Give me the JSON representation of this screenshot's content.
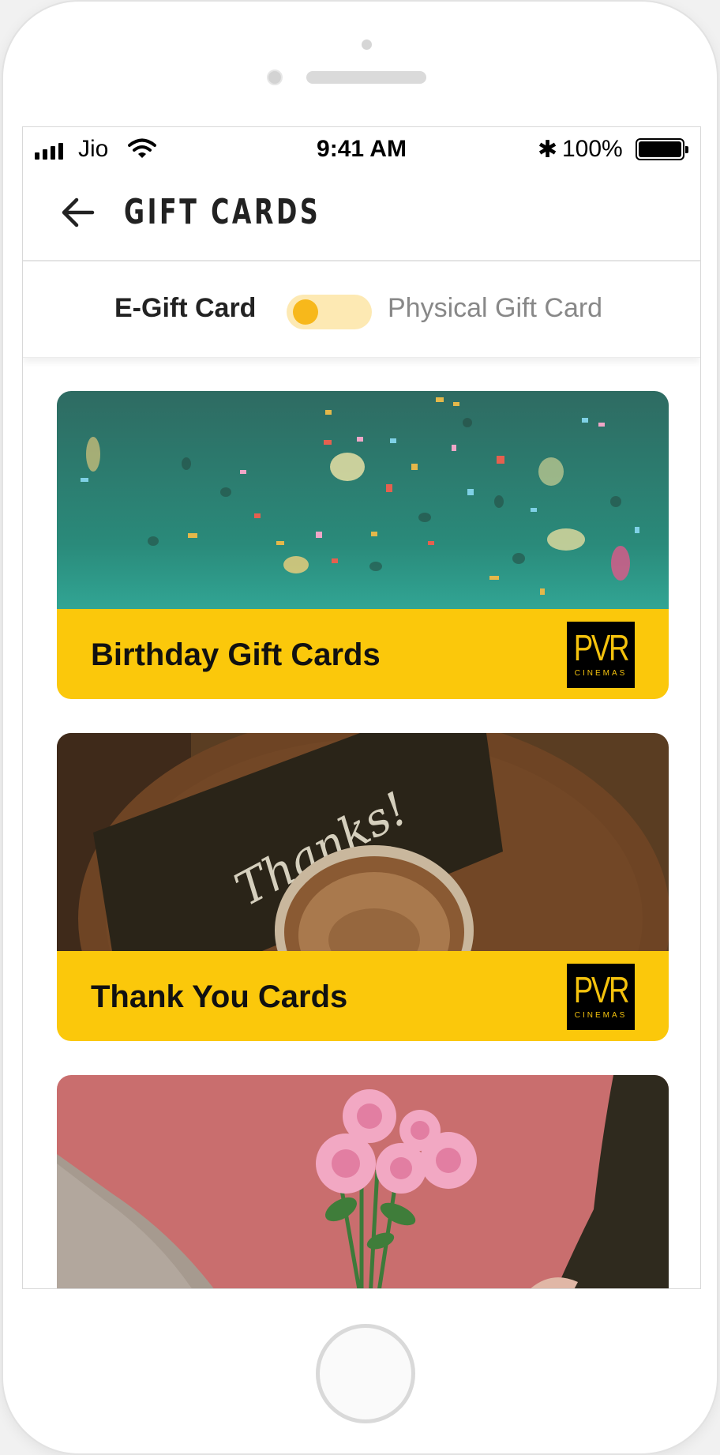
{
  "status_bar": {
    "carrier": "Jio",
    "time": "9:41 AM",
    "battery": "100%",
    "icons": [
      "signal-icon",
      "wifi-icon",
      "bluetooth-icon",
      "battery-icon"
    ]
  },
  "header": {
    "title": "GIFT CARDS",
    "back_icon": "arrow-left-icon"
  },
  "toggle": {
    "left_label": "E-Gift Card",
    "right_label": "Physical Gift Card",
    "accent": "#f7b81b",
    "track": "#fde9b3"
  },
  "cards": [
    {
      "label": "Birthday Gift Cards",
      "logo": "PVR",
      "logo_sub": "CINEMAS"
    },
    {
      "label": "Thank You Cards",
      "logo": "PVR",
      "logo_sub": "CINEMAS",
      "photo_text": "Thanks!"
    },
    {
      "label": ""
    }
  ],
  "colors": {
    "brand_yellow": "#fbc80b",
    "logo_bg": "#000000",
    "logo_text": "#f4c20d"
  }
}
